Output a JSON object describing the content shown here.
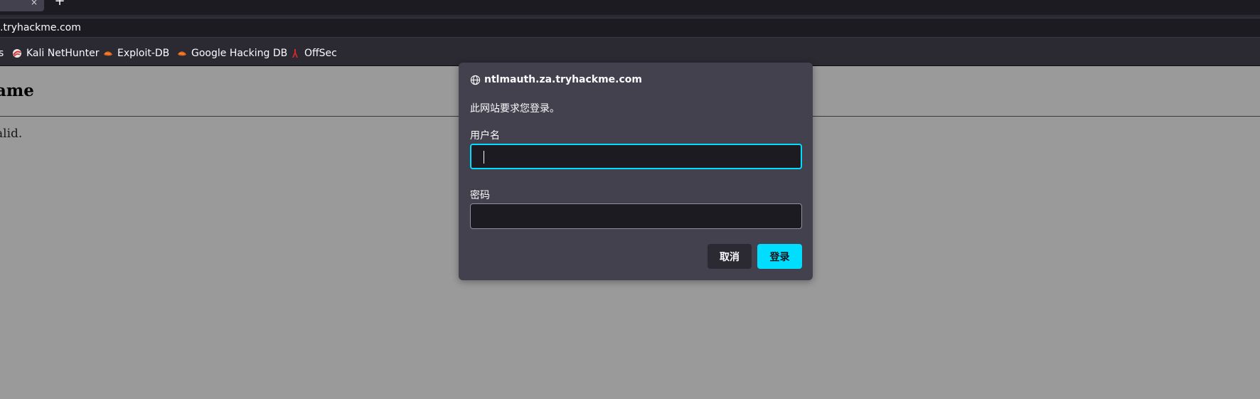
{
  "browser": {
    "new_tab_symbol": "+",
    "tab_close_symbol": "×",
    "url": ".tryhackme.com"
  },
  "bookmarks": [
    {
      "label": "s",
      "icon": "truncated-icon"
    },
    {
      "label": "Kali NetHunter",
      "icon": "kali-nethunter-icon"
    },
    {
      "label": "Exploit-DB",
      "icon": "exploit-db-icon"
    },
    {
      "label": "Google Hacking DB",
      "icon": "ghdb-icon"
    },
    {
      "label": "OffSec",
      "icon": "offsec-icon"
    }
  ],
  "page": {
    "heading": "ame",
    "text": "alid."
  },
  "dialog": {
    "host": "ntlmauth.za.tryhackme.com",
    "message": "此网站要求您登录。",
    "username_label": "用户名",
    "username_value": "",
    "password_label": "密码",
    "password_value": "",
    "cancel_label": "取消",
    "login_label": "登录"
  },
  "colors": {
    "accent": "#00ddff",
    "dialog_bg": "#42414d",
    "field_bg": "#1c1b22",
    "page_overlay": "#9a9a9b"
  }
}
